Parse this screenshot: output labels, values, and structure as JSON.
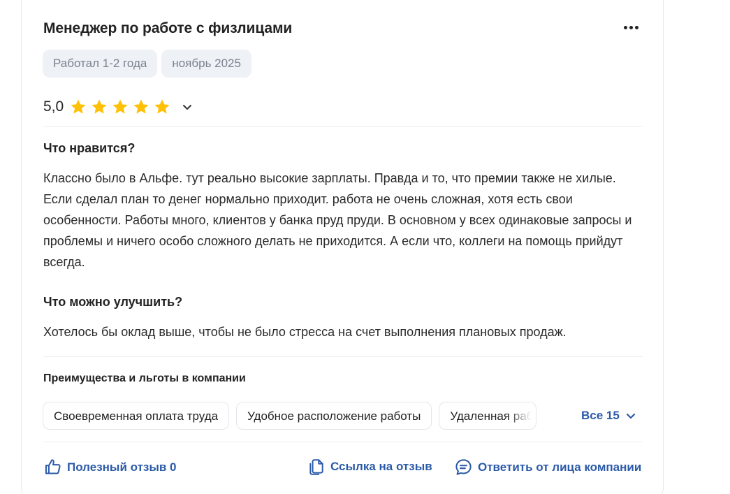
{
  "review": {
    "title": "Менеджер по работе с физлицами",
    "tags": [
      "Работал 1-2 года",
      "ноябрь 2025"
    ],
    "rating": "5,0",
    "rating_stars": 5,
    "star_color": "#ffc107",
    "likes_heading": "Что нравится?",
    "likes_text": "Классно было в Альфе. тут реально высокие зарплаты. Правда и то, что премии также не хилые. Если сделал план то денег нормально приходит. работа не очень сложная, хотя есть свои особенности. Работы много, клиентов у банка пруд пруди. В основном у всех одинаковые запросы и проблемы и ничего особо сложного делать не приходится. А если что, коллеги на помощь прийдут всегда.",
    "improve_heading": "Что можно улучшить?",
    "improve_text": "Хотелось бы оклад выше, чтобы не было стресса на счет выполнения плановых продаж."
  },
  "benefits": {
    "heading": "Преимущества и льготы в компании",
    "chips": [
      "Своевременная оплата труда",
      "Удобное расположение работы",
      "Удаленная работа"
    ],
    "all_label": "Все 15"
  },
  "footer": {
    "helpful": "Полезный отзыв 0",
    "link": "Ссылка на отзыв",
    "reply": "Ответить от лица компании"
  },
  "icons": {
    "more": "more-horizontal-icon",
    "expand": "chevron-down-icon",
    "like": "thumb-up-icon",
    "copy": "copy-link-icon",
    "reply": "chat-bubble-icon"
  },
  "colors": {
    "accent": "#2b5aa8",
    "tag_bg": "#eef1f5"
  }
}
